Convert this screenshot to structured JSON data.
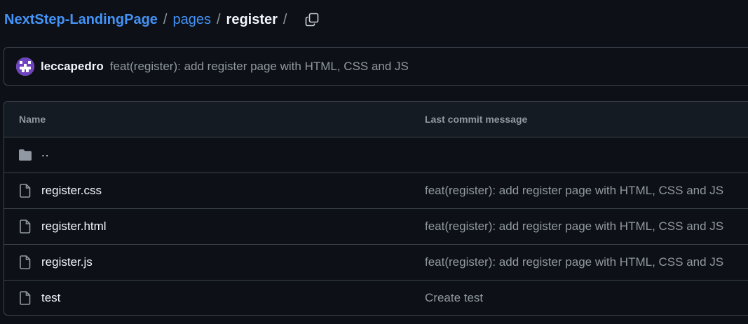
{
  "breadcrumb": {
    "repo": "NextStep-LandingPage",
    "folder": "pages",
    "current": "register",
    "separator": "/"
  },
  "commit": {
    "author": "leccapedro",
    "message": "feat(register): add register page with HTML, CSS and JS"
  },
  "table": {
    "headers": {
      "name": "Name",
      "last_commit": "Last commit message"
    },
    "parent": "..",
    "rows": [
      {
        "name": "register.css",
        "message": "feat(register): add register page with HTML, CSS and JS",
        "icon": "file-icon"
      },
      {
        "name": "register.html",
        "message": "feat(register): add register page with HTML, CSS and JS",
        "icon": "file-icon"
      },
      {
        "name": "register.js",
        "message": "feat(register): add register page with HTML, CSS and JS",
        "icon": "file-icon"
      },
      {
        "name": "test",
        "message": "Create test",
        "icon": "file-icon"
      }
    ]
  },
  "colors": {
    "background": "#0d1117",
    "link": "#4493f8",
    "border": "#3d444d",
    "muted": "#9198a1",
    "header_bg": "#151b23",
    "avatar_accent": "#6f42c1"
  }
}
